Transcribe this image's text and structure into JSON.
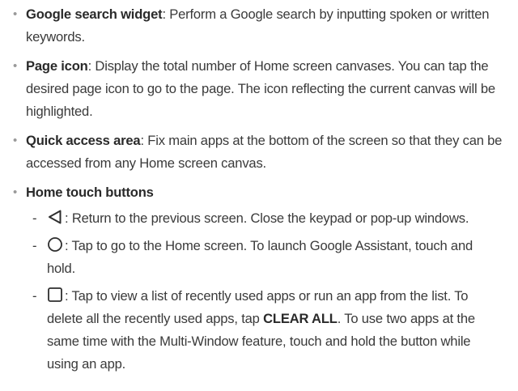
{
  "items": [
    {
      "term": "Google search widget",
      "sep": ":",
      "desc": " Perform a Google search by inputting spoken or written keywords."
    },
    {
      "term": "Page icon",
      "sep": ":",
      "desc": " Display the total number of Home screen canvases. You can tap the desired page icon to go to the page. The icon reflecting the current canvas will be highlighted."
    },
    {
      "term": "Quick access area",
      "sep": ":",
      "desc": " Fix main apps at the bottom of the screen so that they can be accessed from any Home screen canvas."
    },
    {
      "term": "Home touch buttons"
    }
  ],
  "buttons": [
    {
      "icon": "back-triangle-icon",
      "desc": ": Return to the previous screen. Close the keypad or pop-up windows."
    },
    {
      "icon": "home-circle-icon",
      "desc": ": Tap to go to the Home screen. To launch Google Assistant, touch and hold."
    },
    {
      "icon": "recent-apps-square-icon",
      "desc_a": ": Tap to view a list of recently used apps or run an app from the list. To delete all the recently used apps, tap ",
      "strong": "CLEAR ALL",
      "desc_b": ". To use two apps at the same time with the Multi-Window feature, touch and hold the button while using an app."
    }
  ],
  "bullet_char": "•",
  "dash_char": "-",
  "colors": {
    "text": "#3a3a3a",
    "bullet": "#9a9a9a"
  }
}
